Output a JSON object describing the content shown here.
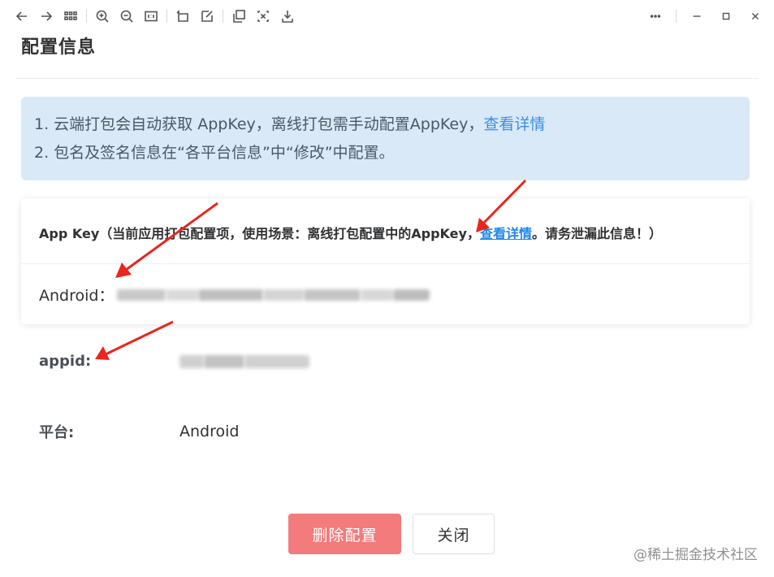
{
  "title": "配置信息",
  "info": {
    "line1_text": "1. 云端打包会自动获取 AppKey，离线打包需手动配置AppKey，",
    "line1_link": "查看详情",
    "line2_text": "2. 包名及签名信息在“各平台信息”中“修改”中配置。"
  },
  "card": {
    "header_text": "App Key（当前应用打包配置项，使用场景：离线打包配置中的AppKey，",
    "header_link": "查看详情",
    "header_tail": "。请务泄漏此信息！）",
    "android_label": "Android："
  },
  "rows": {
    "appid_label": "appid:",
    "platform_label": "平台:",
    "platform_value": "Android"
  },
  "buttons": {
    "delete": "删除配置",
    "close": "关闭"
  },
  "watermark": "@稀土掘金技术社区",
  "colors": {
    "info_bg": "#d9e9f7",
    "link": "#3a8ee6",
    "danger": "#f37b7b",
    "arrow": "#e8261f"
  },
  "toolbar": {
    "icons": [
      "back-icon",
      "forward-icon",
      "grid-icon",
      "zoom-in-icon",
      "zoom-out-icon",
      "actual-size-icon",
      "rotate-icon",
      "edit-icon",
      "copy-icon",
      "crop-icon",
      "download-icon"
    ],
    "window_icons": [
      "more-icon",
      "minimize-icon",
      "maximize-icon",
      "close-icon"
    ]
  }
}
